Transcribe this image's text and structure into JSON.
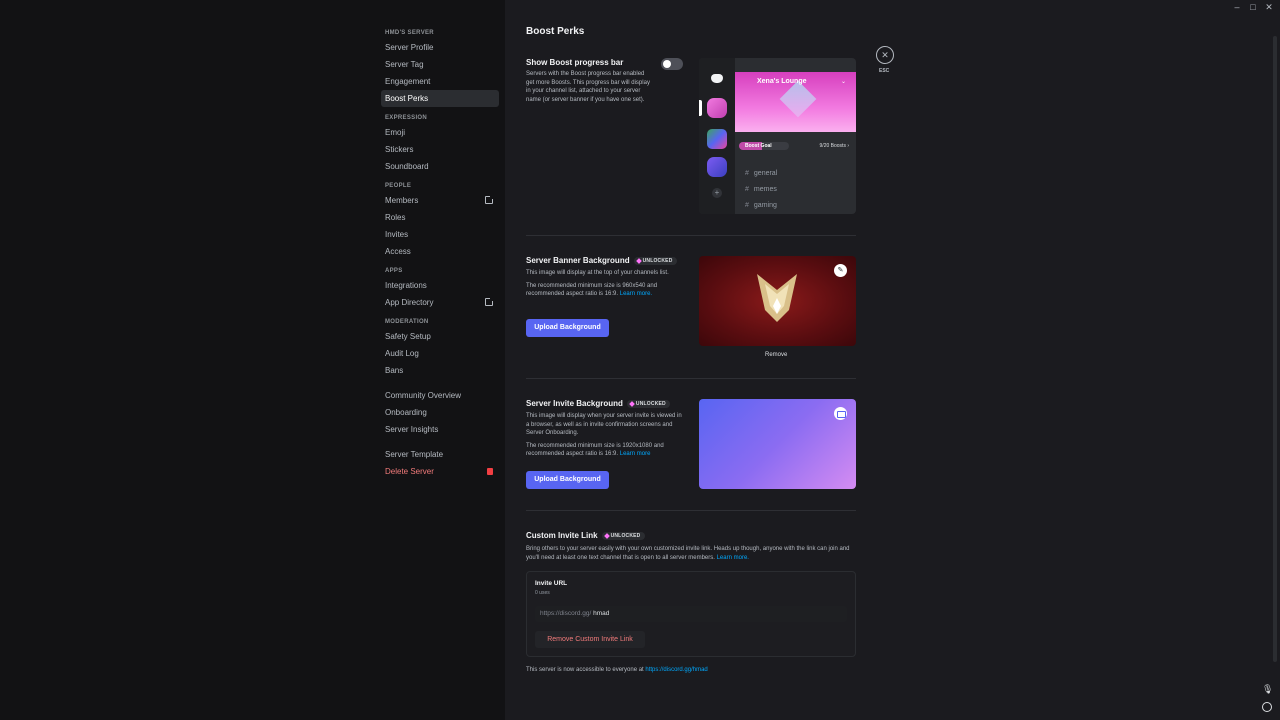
{
  "sidebar": {
    "server_header": "HMD'S SERVER",
    "groups": [
      {
        "items": [
          "Server Profile",
          "Server Tag",
          "Engagement",
          "Boost Perks"
        ]
      },
      {
        "header": "EXPRESSION",
        "items": [
          "Emoji",
          "Stickers",
          "Soundboard"
        ]
      },
      {
        "header": "PEOPLE",
        "items": [
          "Members",
          "Roles",
          "Invites",
          "Access"
        ]
      },
      {
        "header": "APPS",
        "items": [
          "Integrations",
          "App Directory"
        ]
      },
      {
        "header": "MODERATION",
        "items": [
          "Safety Setup",
          "Audit Log",
          "Bans"
        ]
      }
    ],
    "server_profile": "Server Profile",
    "server_tag": "Server Tag",
    "engagement": "Engagement",
    "boost_perks": "Boost Perks",
    "expression_header": "EXPRESSION",
    "emoji": "Emoji",
    "stickers": "Stickers",
    "soundboard": "Soundboard",
    "people_header": "PEOPLE",
    "members": "Members",
    "roles": "Roles",
    "invites": "Invites",
    "access": "Access",
    "apps_header": "APPS",
    "integrations": "Integrations",
    "app_directory": "App Directory",
    "moderation_header": "MODERATION",
    "safety_setup": "Safety Setup",
    "audit_log": "Audit Log",
    "bans": "Bans",
    "community_overview": "Community Overview",
    "onboarding": "Onboarding",
    "server_insights": "Server Insights",
    "server_template": "Server Template",
    "delete_server": "Delete Server"
  },
  "main": {
    "title": "Boost Perks",
    "esc": "ESC",
    "progress": {
      "title": "Show Boost progress bar",
      "desc": "Servers with the Boost progress bar enabled get more Boosts. This progress bar will display in your channel list, attached to your server name (or server banner if you have one set).",
      "enabled": false
    },
    "preview": {
      "server_name": "Xena's Lounge",
      "goal_label": "Boost Goal",
      "goal_count": "9/20 Boosts",
      "goal_fraction": 0.45,
      "channels": [
        "general",
        "memes",
        "gaming"
      ]
    },
    "banner": {
      "title": "Server Banner Background",
      "badge": "UNLOCKED",
      "desc": "This image will display at the top of your channels list.",
      "rec": "The recommended minimum size is 960x540 and recommended aspect ratio is 16:9.",
      "learn_more": "Learn more.",
      "button": "Upload Background",
      "remove": "Remove"
    },
    "invite_bg": {
      "title": "Server Invite Background",
      "badge": "UNLOCKED",
      "desc": "This image will display when your server invite is viewed in a browser, as well as in invite confirmation screens and Server Onboarding.",
      "rec": "The recommended minimum size is 1920x1080 and recommended aspect ratio is 16:9.",
      "learn_more": "Learn more",
      "button": "Upload Background"
    },
    "custom_invite": {
      "title": "Custom Invite Link",
      "badge": "UNLOCKED",
      "desc": "Bring others to your server easily with your own customized invite link. Heads up though, anyone with the link can join and you'll need at least one text channel that is open to all server members.",
      "learn_more": "Learn more.",
      "url_label": "Invite URL",
      "uses": "0 uses",
      "prefix": "https://discord.gg/",
      "code": "hmad",
      "remove_button": "Remove Custom Invite Link",
      "accessible_text": "This server is now accessible to everyone at",
      "accessible_link": "https://discord.gg/hmad"
    }
  },
  "colors": {
    "accent": "#5865f2",
    "danger": "#f27b7b",
    "link": "#00a8fc",
    "boost_pink": "#ff73fa"
  }
}
